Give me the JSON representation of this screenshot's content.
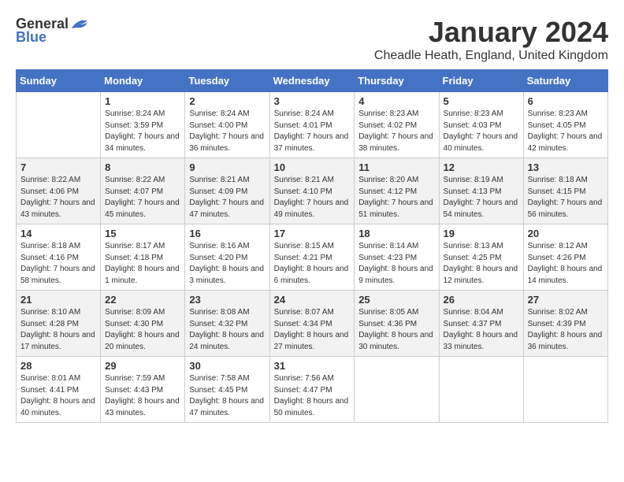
{
  "header": {
    "logo_general": "General",
    "logo_blue": "Blue",
    "month": "January 2024",
    "location": "Cheadle Heath, England, United Kingdom"
  },
  "columns": [
    "Sunday",
    "Monday",
    "Tuesday",
    "Wednesday",
    "Thursday",
    "Friday",
    "Saturday"
  ],
  "weeks": [
    [
      {
        "day": "",
        "sunrise": "",
        "sunset": "",
        "daylight": ""
      },
      {
        "day": "1",
        "sunrise": "Sunrise: 8:24 AM",
        "sunset": "Sunset: 3:59 PM",
        "daylight": "Daylight: 7 hours and 34 minutes."
      },
      {
        "day": "2",
        "sunrise": "Sunrise: 8:24 AM",
        "sunset": "Sunset: 4:00 PM",
        "daylight": "Daylight: 7 hours and 36 minutes."
      },
      {
        "day": "3",
        "sunrise": "Sunrise: 8:24 AM",
        "sunset": "Sunset: 4:01 PM",
        "daylight": "Daylight: 7 hours and 37 minutes."
      },
      {
        "day": "4",
        "sunrise": "Sunrise: 8:23 AM",
        "sunset": "Sunset: 4:02 PM",
        "daylight": "Daylight: 7 hours and 38 minutes."
      },
      {
        "day": "5",
        "sunrise": "Sunrise: 8:23 AM",
        "sunset": "Sunset: 4:03 PM",
        "daylight": "Daylight: 7 hours and 40 minutes."
      },
      {
        "day": "6",
        "sunrise": "Sunrise: 8:23 AM",
        "sunset": "Sunset: 4:05 PM",
        "daylight": "Daylight: 7 hours and 42 minutes."
      }
    ],
    [
      {
        "day": "7",
        "sunrise": "Sunrise: 8:22 AM",
        "sunset": "Sunset: 4:06 PM",
        "daylight": "Daylight: 7 hours and 43 minutes."
      },
      {
        "day": "8",
        "sunrise": "Sunrise: 8:22 AM",
        "sunset": "Sunset: 4:07 PM",
        "daylight": "Daylight: 7 hours and 45 minutes."
      },
      {
        "day": "9",
        "sunrise": "Sunrise: 8:21 AM",
        "sunset": "Sunset: 4:09 PM",
        "daylight": "Daylight: 7 hours and 47 minutes."
      },
      {
        "day": "10",
        "sunrise": "Sunrise: 8:21 AM",
        "sunset": "Sunset: 4:10 PM",
        "daylight": "Daylight: 7 hours and 49 minutes."
      },
      {
        "day": "11",
        "sunrise": "Sunrise: 8:20 AM",
        "sunset": "Sunset: 4:12 PM",
        "daylight": "Daylight: 7 hours and 51 minutes."
      },
      {
        "day": "12",
        "sunrise": "Sunrise: 8:19 AM",
        "sunset": "Sunset: 4:13 PM",
        "daylight": "Daylight: 7 hours and 54 minutes."
      },
      {
        "day": "13",
        "sunrise": "Sunrise: 8:18 AM",
        "sunset": "Sunset: 4:15 PM",
        "daylight": "Daylight: 7 hours and 56 minutes."
      }
    ],
    [
      {
        "day": "14",
        "sunrise": "Sunrise: 8:18 AM",
        "sunset": "Sunset: 4:16 PM",
        "daylight": "Daylight: 7 hours and 58 minutes."
      },
      {
        "day": "15",
        "sunrise": "Sunrise: 8:17 AM",
        "sunset": "Sunset: 4:18 PM",
        "daylight": "Daylight: 8 hours and 1 minute."
      },
      {
        "day": "16",
        "sunrise": "Sunrise: 8:16 AM",
        "sunset": "Sunset: 4:20 PM",
        "daylight": "Daylight: 8 hours and 3 minutes."
      },
      {
        "day": "17",
        "sunrise": "Sunrise: 8:15 AM",
        "sunset": "Sunset: 4:21 PM",
        "daylight": "Daylight: 8 hours and 6 minutes."
      },
      {
        "day": "18",
        "sunrise": "Sunrise: 8:14 AM",
        "sunset": "Sunset: 4:23 PM",
        "daylight": "Daylight: 8 hours and 9 minutes."
      },
      {
        "day": "19",
        "sunrise": "Sunrise: 8:13 AM",
        "sunset": "Sunset: 4:25 PM",
        "daylight": "Daylight: 8 hours and 12 minutes."
      },
      {
        "day": "20",
        "sunrise": "Sunrise: 8:12 AM",
        "sunset": "Sunset: 4:26 PM",
        "daylight": "Daylight: 8 hours and 14 minutes."
      }
    ],
    [
      {
        "day": "21",
        "sunrise": "Sunrise: 8:10 AM",
        "sunset": "Sunset: 4:28 PM",
        "daylight": "Daylight: 8 hours and 17 minutes."
      },
      {
        "day": "22",
        "sunrise": "Sunrise: 8:09 AM",
        "sunset": "Sunset: 4:30 PM",
        "daylight": "Daylight: 8 hours and 20 minutes."
      },
      {
        "day": "23",
        "sunrise": "Sunrise: 8:08 AM",
        "sunset": "Sunset: 4:32 PM",
        "daylight": "Daylight: 8 hours and 24 minutes."
      },
      {
        "day": "24",
        "sunrise": "Sunrise: 8:07 AM",
        "sunset": "Sunset: 4:34 PM",
        "daylight": "Daylight: 8 hours and 27 minutes."
      },
      {
        "day": "25",
        "sunrise": "Sunrise: 8:05 AM",
        "sunset": "Sunset: 4:36 PM",
        "daylight": "Daylight: 8 hours and 30 minutes."
      },
      {
        "day": "26",
        "sunrise": "Sunrise: 8:04 AM",
        "sunset": "Sunset: 4:37 PM",
        "daylight": "Daylight: 8 hours and 33 minutes."
      },
      {
        "day": "27",
        "sunrise": "Sunrise: 8:02 AM",
        "sunset": "Sunset: 4:39 PM",
        "daylight": "Daylight: 8 hours and 36 minutes."
      }
    ],
    [
      {
        "day": "28",
        "sunrise": "Sunrise: 8:01 AM",
        "sunset": "Sunset: 4:41 PM",
        "daylight": "Daylight: 8 hours and 40 minutes."
      },
      {
        "day": "29",
        "sunrise": "Sunrise: 7:59 AM",
        "sunset": "Sunset: 4:43 PM",
        "daylight": "Daylight: 8 hours and 43 minutes."
      },
      {
        "day": "30",
        "sunrise": "Sunrise: 7:58 AM",
        "sunset": "Sunset: 4:45 PM",
        "daylight": "Daylight: 8 hours and 47 minutes."
      },
      {
        "day": "31",
        "sunrise": "Sunrise: 7:56 AM",
        "sunset": "Sunset: 4:47 PM",
        "daylight": "Daylight: 8 hours and 50 minutes."
      },
      {
        "day": "",
        "sunrise": "",
        "sunset": "",
        "daylight": ""
      },
      {
        "day": "",
        "sunrise": "",
        "sunset": "",
        "daylight": ""
      },
      {
        "day": "",
        "sunrise": "",
        "sunset": "",
        "daylight": ""
      }
    ]
  ]
}
